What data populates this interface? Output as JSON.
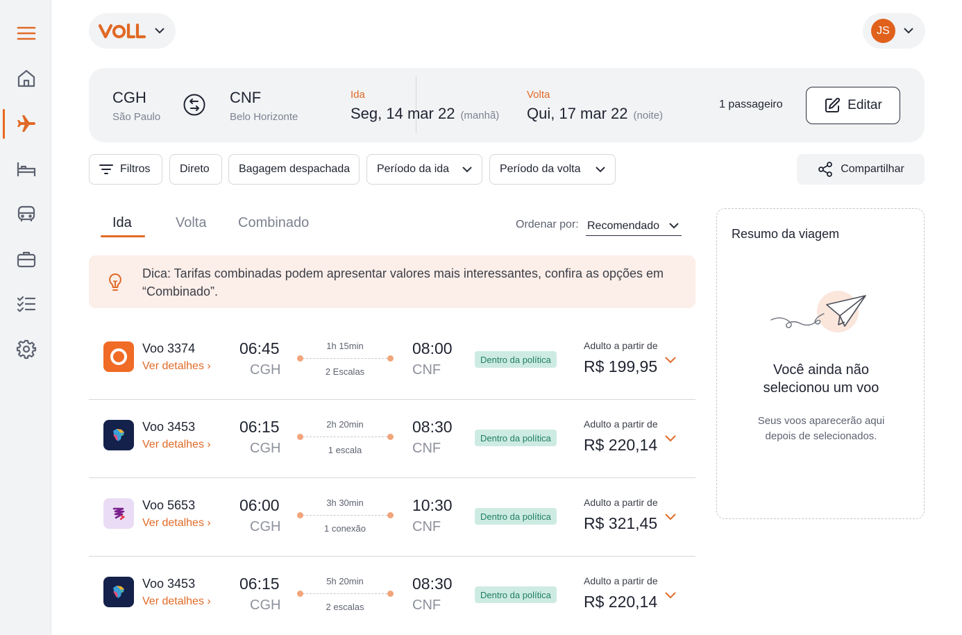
{
  "brand": {
    "name": "VOLL"
  },
  "user": {
    "initials": "JS"
  },
  "sidebar": {
    "items": [
      {
        "icon": "menu-icon"
      },
      {
        "icon": "home-icon"
      },
      {
        "icon": "airplane-icon"
      },
      {
        "icon": "bed-icon"
      },
      {
        "icon": "bus-icon"
      },
      {
        "icon": "briefcase-icon"
      },
      {
        "icon": "checklist-icon"
      },
      {
        "icon": "gear-icon"
      }
    ]
  },
  "search": {
    "origin_code": "CGH",
    "origin_city": "São Paulo",
    "dest_code": "CNF",
    "dest_city": "Belo Horizonte",
    "outbound_label": "Ida",
    "outbound_date": "Seg, 14 mar 22",
    "outbound_period": "(manhã)",
    "return_label": "Volta",
    "return_date": "Qui, 17 mar 22",
    "return_period": "(noite)",
    "passengers": "1 passageiro",
    "edit_label": "Editar"
  },
  "filters": {
    "filters_label": "Filtros",
    "direct_label": "Direto",
    "baggage_label": "Bagagem despachada",
    "outbound_period_label": "Período da ida",
    "return_period_label": "Período da volta",
    "share_label": "Compartilhar"
  },
  "tabs": {
    "outbound": "Ida",
    "return": "Volta",
    "combined": "Combinado"
  },
  "sort": {
    "label": "Ordenar por:",
    "value": "Recomendado"
  },
  "tip": {
    "text": "Dica: Tarifas combinadas podem apresentar valores mais interessantes, confira as opções em “Combinado”."
  },
  "flights": [
    {
      "number": "Voo 3374",
      "details": "Ver detalhes",
      "dep_time": "06:45",
      "dep_apt": "CGH",
      "duration": "1h 15min",
      "stops": "2 Escalas",
      "arr_time": "08:00",
      "arr_apt": "CNF",
      "policy": "Dentro da política",
      "from_label": "Adulto a partir de",
      "price": "R$ 199,95"
    },
    {
      "number": "Voo 3453",
      "details": "Ver detalhes",
      "dep_time": "06:15",
      "dep_apt": "CGH",
      "duration": "2h 20min",
      "stops": "1 escala",
      "arr_time": "08:30",
      "arr_apt": "CNF",
      "policy": "Dentro da política",
      "from_label": "Adulto a partir de",
      "price": "R$ 220,14"
    },
    {
      "number": "Voo 5653",
      "details": "Ver detalhes",
      "dep_time": "06:00",
      "dep_apt": "CGH",
      "duration": "3h 30min",
      "stops": "1 conexão",
      "arr_time": "10:30",
      "arr_apt": "CNF",
      "policy": "Dentro da política",
      "from_label": "Adulto a partir de",
      "price": "R$ 321,45"
    },
    {
      "number": "Voo 3453",
      "details": "Ver detalhes",
      "dep_time": "06:15",
      "dep_apt": "CGH",
      "duration": "5h 20min",
      "stops": "2 escalas",
      "arr_time": "08:30",
      "arr_apt": "CNF",
      "policy": "Dentro da política",
      "from_label": "Adulto a partir de",
      "price": "R$ 220,14"
    }
  ],
  "summary": {
    "title": "Resumo da viagem",
    "heading": "Você ainda não selecionou um voo",
    "subtitle": "Seus voos aparecerão aqui depois de selecionados."
  },
  "colors": {
    "accent": "#e06a26",
    "policy_bg": "#cdebe2",
    "policy_text": "#1f7d62",
    "tip_bg": "#fceee8"
  }
}
